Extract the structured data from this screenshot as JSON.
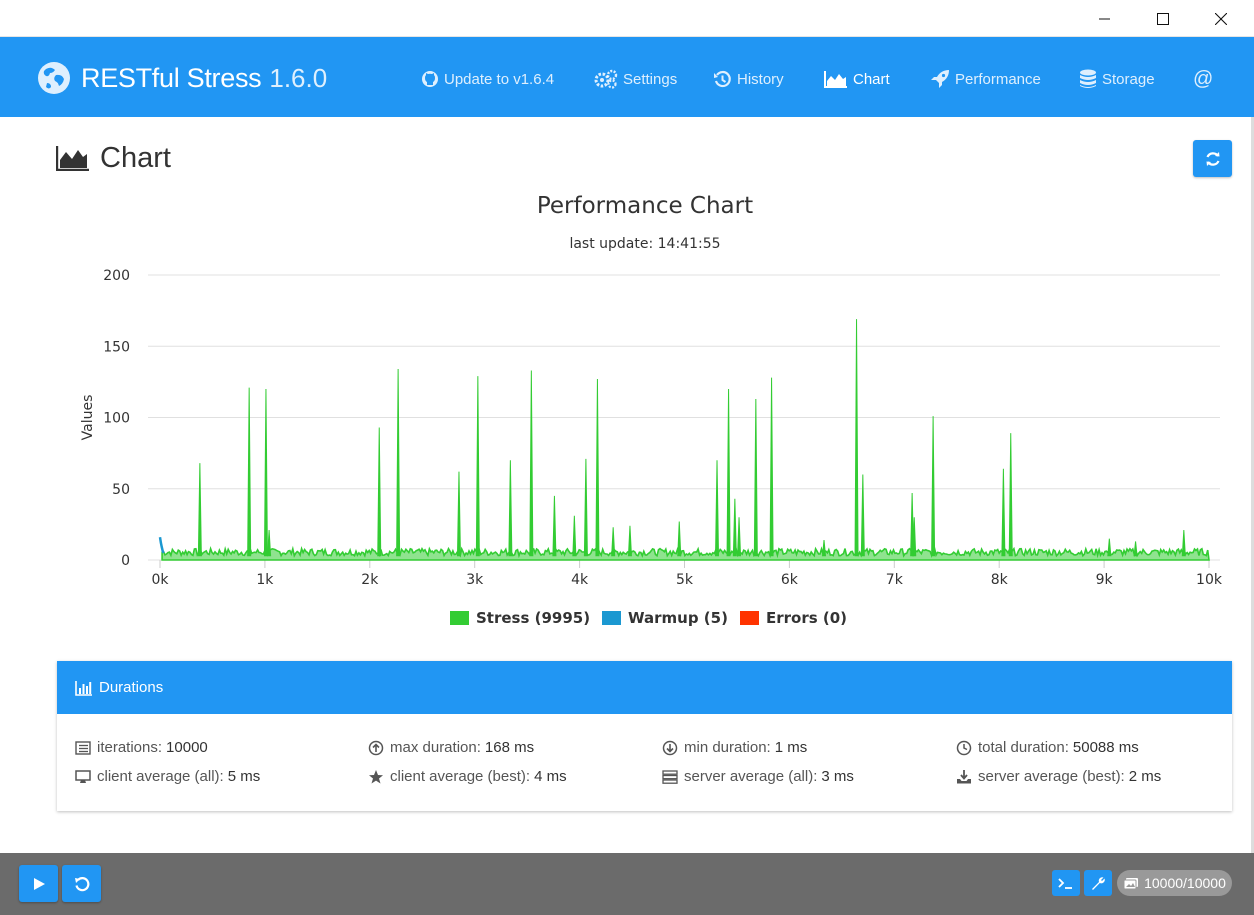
{
  "window": {
    "controls": [
      "minimize",
      "maximize",
      "close"
    ]
  },
  "app": {
    "name": "RESTful Stress",
    "version": "1.6.0"
  },
  "nav": [
    {
      "label": "Update to v1.6.4",
      "icon": "github-icon"
    },
    {
      "label": "Settings",
      "icon": "gears-icon"
    },
    {
      "label": "History",
      "icon": "history-icon"
    },
    {
      "label": "Chart",
      "icon": "area-chart-icon",
      "active": true
    },
    {
      "label": "Performance",
      "icon": "rocket-icon"
    },
    {
      "label": "Storage",
      "icon": "database-icon"
    },
    {
      "label": "@",
      "icon": "at-icon"
    }
  ],
  "page": {
    "title": "Chart"
  },
  "chart": {
    "title": "Performance Chart",
    "subtitle": "last update: 14:41:55"
  },
  "chart_data": {
    "type": "area",
    "title": "Performance Chart",
    "subtitle": "last update: 14:41:55",
    "ylabel": "Values",
    "xlabel": "",
    "xlim": [
      0,
      10000
    ],
    "ylim": [
      0,
      200
    ],
    "x_ticks": [
      "0k",
      "1k",
      "2k",
      "3k",
      "4k",
      "5k",
      "6k",
      "7k",
      "8k",
      "9k",
      "10k"
    ],
    "y_ticks": [
      "0",
      "50",
      "100",
      "150",
      "200"
    ],
    "grid": true,
    "legend_position": "bottom",
    "baseline": 5,
    "series": [
      {
        "name": "Stress (9995)",
        "color": "#33cc33",
        "x": [
          380,
          850,
          1010,
          1040,
          2090,
          2270,
          2850,
          3030,
          3340,
          3540,
          3760,
          3950,
          4060,
          4170,
          4320,
          4480,
          4950,
          5310,
          5420,
          5480,
          5520,
          5680,
          5830,
          6330,
          6640,
          6700,
          7170,
          7190,
          7370,
          8040,
          8110,
          9050,
          9300,
          9760
        ],
        "values": [
          68,
          121,
          120,
          21,
          93,
          134,
          62,
          129,
          70,
          133,
          45,
          31,
          71,
          127,
          23,
          24,
          27,
          70,
          120,
          43,
          30,
          113,
          128,
          14,
          169,
          60,
          47,
          30,
          101,
          64,
          89,
          15,
          13,
          21
        ]
      },
      {
        "name": "Warmup (5)",
        "color": "#1b98d1",
        "x": [
          0,
          5,
          10,
          15,
          20
        ],
        "values": [
          16,
          12,
          9,
          6,
          5
        ]
      },
      {
        "name": "Errors (0)",
        "color": "#ff3300",
        "x": [],
        "values": []
      }
    ]
  },
  "durations": {
    "title": "Durations",
    "stats": [
      {
        "label": "iterations:",
        "value": "10000",
        "icon": "list-icon"
      },
      {
        "label": "max duration:",
        "value": "168 ms",
        "icon": "arrow-circle-up-icon"
      },
      {
        "label": "min duration:",
        "value": "1 ms",
        "icon": "arrow-circle-down-icon"
      },
      {
        "label": "total duration:",
        "value": "50088 ms",
        "icon": "clock-icon"
      },
      {
        "label": "client average (all):",
        "value": "5 ms",
        "icon": "desktop-icon"
      },
      {
        "label": "client average (best):",
        "value": "4 ms",
        "icon": "star-icon"
      },
      {
        "label": "server average (all):",
        "value": "3 ms",
        "icon": "server-icon"
      },
      {
        "label": "server average (best):",
        "value": "2 ms",
        "icon": "download-icon"
      }
    ]
  },
  "footer": {
    "counter": "10000/10000"
  },
  "colors": {
    "accent": "#2196f3",
    "footer": "#6b6b6b",
    "stress": "#33cc33",
    "warmup": "#1b98d1",
    "errors": "#ff3300"
  }
}
